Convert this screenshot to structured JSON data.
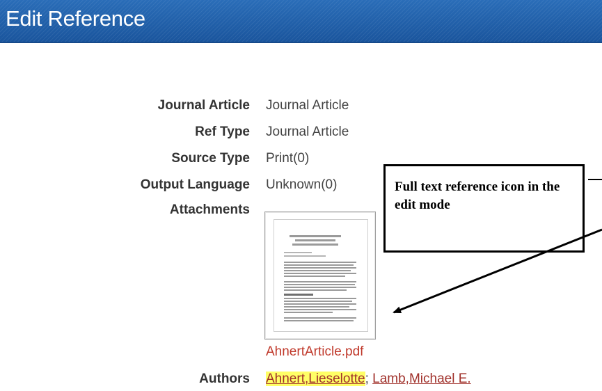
{
  "header": {
    "title": "Edit Reference"
  },
  "fields": [
    {
      "label": "Journal Article",
      "value": "Journal Article"
    },
    {
      "label": "Ref Type",
      "value": "Journal Article"
    },
    {
      "label": "Source Type",
      "value": "Print(0)"
    },
    {
      "label": "Output Language",
      "value": "Unknown(0)"
    }
  ],
  "attachments": {
    "label": "Attachments",
    "file_name": "AhnertArticle.pdf",
    "thumbnail_icon": "pdf-document-thumbnail-icon"
  },
  "authors": {
    "label": "Authors",
    "separator": ";",
    "items": [
      {
        "name": "Ahnert,Lieselotte",
        "highlighted": true
      },
      {
        "name": "Lamb,Michael E.",
        "highlighted": false
      }
    ]
  },
  "callout": {
    "text": "Full text reference icon in the edit mode"
  },
  "colors": {
    "header_bg": "#1f5ea8",
    "link": "#c0392b",
    "highlight": "#ffff66"
  }
}
